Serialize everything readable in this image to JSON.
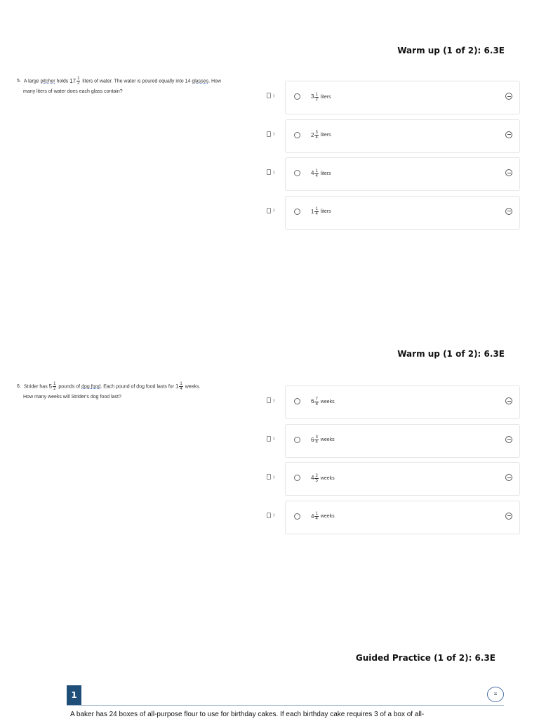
{
  "sections": [
    {
      "header": "Warm up (1 of 2): 6.3E",
      "question": {
        "number": "5.",
        "parts": {
          "a": "A large ",
          "pitcher": "pitcher",
          "b": " holds ",
          "whole": "17",
          "fnum": "1",
          "fden": "2",
          "c": " liters of water. The water is poured equally into 14 ",
          "glasses": "glasses",
          "d": ". How",
          "line2": "many liters of water does each glass contain?"
        }
      },
      "choices": [
        {
          "whole": "3",
          "num": "1",
          "den": "2",
          "unit": "liters"
        },
        {
          "whole": "2",
          "num": "3",
          "den": "4",
          "unit": "liters"
        },
        {
          "whole": "4",
          "num": "1",
          "den": "4",
          "unit": "liters"
        },
        {
          "whole": "1",
          "num": "1",
          "den": "4",
          "unit": "liters"
        }
      ]
    },
    {
      "header": "Warm up (1 of 2): 6.3E",
      "question": {
        "number": "6.",
        "parts": {
          "a": "Strider has ",
          "w1": "5",
          "n1": "1",
          "d1": "2",
          "b": " pounds of ",
          "dogfood": "dog food",
          "c": ". Each pound of dog food lasts for ",
          "w2": "1",
          "n2": "1",
          "d2": "4",
          "e": " weeks.",
          "line2": "How many weeks will Strider's dog food last?"
        }
      },
      "choices": [
        {
          "whole": "6",
          "num": "7",
          "den": "8",
          "unit": "weeks"
        },
        {
          "whole": "6",
          "num": "3",
          "den": "4",
          "unit": "weeks"
        },
        {
          "whole": "4",
          "num": "2",
          "den": "5",
          "unit": "weeks"
        },
        {
          "whole": "4",
          "num": "1",
          "den": "4",
          "unit": "weeks"
        }
      ]
    }
  ],
  "guided": {
    "header": "Guided Practice (1 of 2): 6.3E",
    "number": "1",
    "menu_icon": "≡",
    "text": "A baker has 24 boxes of all-purpose flour to use for birthday cakes. If each birthday cake requires 3 of a box of all-"
  }
}
